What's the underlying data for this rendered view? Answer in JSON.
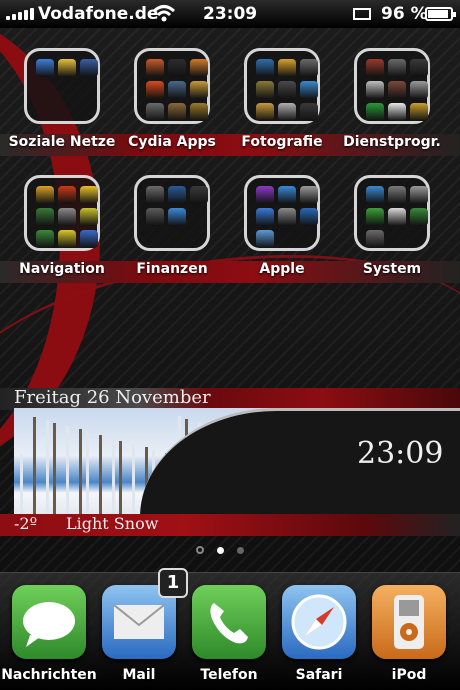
{
  "status_bar": {
    "carrier": "Vodafone.de",
    "time": "23:09",
    "battery": "96 %",
    "battery_level": 0.96
  },
  "folders": [
    {
      "label": "Soziale Netze",
      "icons": [
        "#3f7fd6",
        "#e8c13a",
        "#3b5ea8"
      ]
    },
    {
      "label": "Cydia Apps",
      "icons": [
        "#c85a2a",
        "#2d2d2d",
        "#d07a2a",
        "#d84b1c",
        "#4a6a8a",
        "#c89a3a",
        "#6a6a6a",
        "#8a6a3a",
        "#9a7a2a"
      ]
    },
    {
      "label": "Fotografie",
      "icons": [
        "#2f6fb0",
        "#d7a22a",
        "#6a6a6a",
        "#8a7a3a",
        "#4a4a4a",
        "#3a8ad0",
        "#c89a3a",
        "#b0b0b0",
        "#3a3a3a"
      ]
    },
    {
      "label": "Dienstprogr.",
      "icons": [
        "#9a3a2a",
        "#6a6a6a",
        "#3a3a3a",
        "#c0c0c0",
        "#7a4a3a",
        "#9a9a9a",
        "#2a9a3a",
        "#e8e8e8",
        "#c8a02a"
      ]
    },
    {
      "label": "Navigation",
      "icons": [
        "#d8a02a",
        "#c83a1a",
        "#e8c02a",
        "#3a7a3a",
        "#8a8a8a",
        "#c8c02a",
        "#3a8a3a",
        "#d8c82a",
        "#3a6ac8"
      ]
    },
    {
      "label": "Finanzen",
      "icons": [
        "#6a6a6a",
        "#2a5a9a",
        "#3a3a3a",
        "#5a5a5a",
        "#3a8ad8"
      ]
    },
    {
      "label": "Apple",
      "icons": [
        "#8a3ac8",
        "#3a8ad8",
        "#9a9a9a",
        "#3a7ad8",
        "#8a8a8a",
        "#2a6ab8",
        "#5a9ad8"
      ]
    },
    {
      "label": "System",
      "icons": [
        "#3a8ad0",
        "#7a7a7a",
        "#9a9a9a",
        "#3aa03a",
        "#d8d8d8",
        "#3a8a3a",
        "#6a6a6a"
      ]
    }
  ],
  "weather": {
    "date": "Freitag 26 November",
    "time": "23:09",
    "temperature": "-2º",
    "condition": "Light Snow"
  },
  "page_indicator": {
    "pages": 2,
    "current": 1
  },
  "dock": [
    {
      "label": "Nachrichten",
      "icon": "messages-icon",
      "color": "#3ea83a"
    },
    {
      "label": "Mail",
      "icon": "mail-icon",
      "color": "#3a7ad0",
      "badge": "1"
    },
    {
      "label": "Telefon",
      "icon": "phone-icon",
      "color": "#3ea83a"
    },
    {
      "label": "Safari",
      "icon": "safari-icon",
      "color": "#3a7ad0"
    },
    {
      "label": "iPod",
      "icon": "ipod-icon",
      "color": "#e0852a"
    }
  ]
}
